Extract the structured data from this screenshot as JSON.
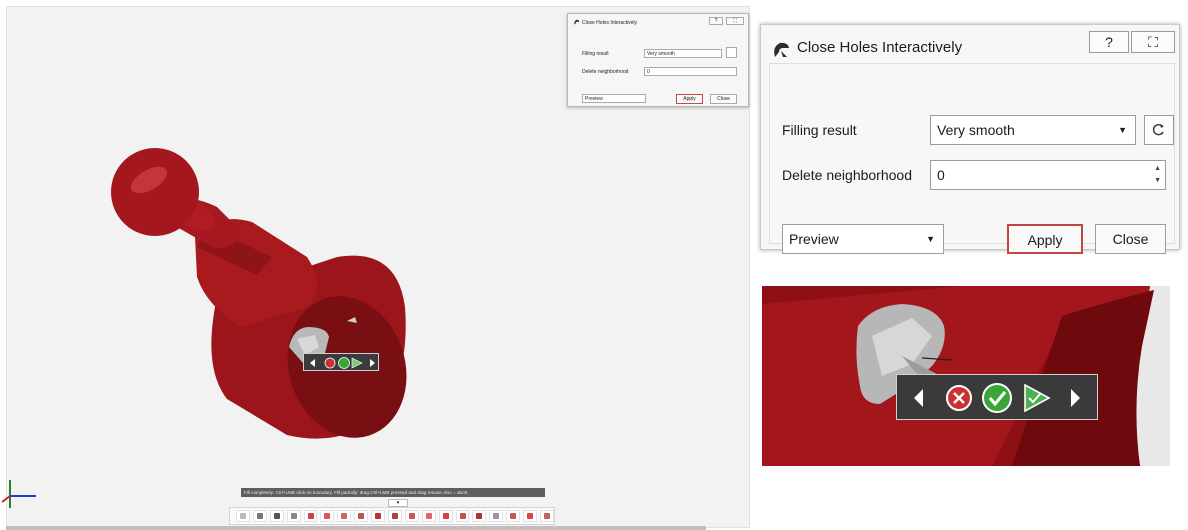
{
  "dialog": {
    "title": "Close Holes Interactively",
    "help_label": "?",
    "close_x_label": "⛶",
    "filling_result_label": "Filling result",
    "filling_result_value": "Very smooth",
    "delete_neighborhood_label": "Delete neighborhood",
    "delete_neighborhood_value": "0",
    "preview_value": "Preview",
    "apply_label": "Apply",
    "close_label": "Close"
  },
  "status_bar": {
    "hint": "Fill completely: Ctrl+LMB click on boundary. Fill partially: drag Ctrl+LMB pressed and drag mouse. Esc = abort."
  },
  "collapse_tab": "▾",
  "mini_toolbar": {
    "icons": [
      "arrow-left-icon",
      "cancel-icon",
      "confirm-icon",
      "confirm-next-icon",
      "arrow-right-icon"
    ]
  },
  "colors": {
    "part_red": "#a3161c",
    "cancel_red": "#c83232",
    "confirm_green": "#3aa63a",
    "toolbar_dark": "#3b3b3b",
    "apply_border": "#c44343"
  }
}
